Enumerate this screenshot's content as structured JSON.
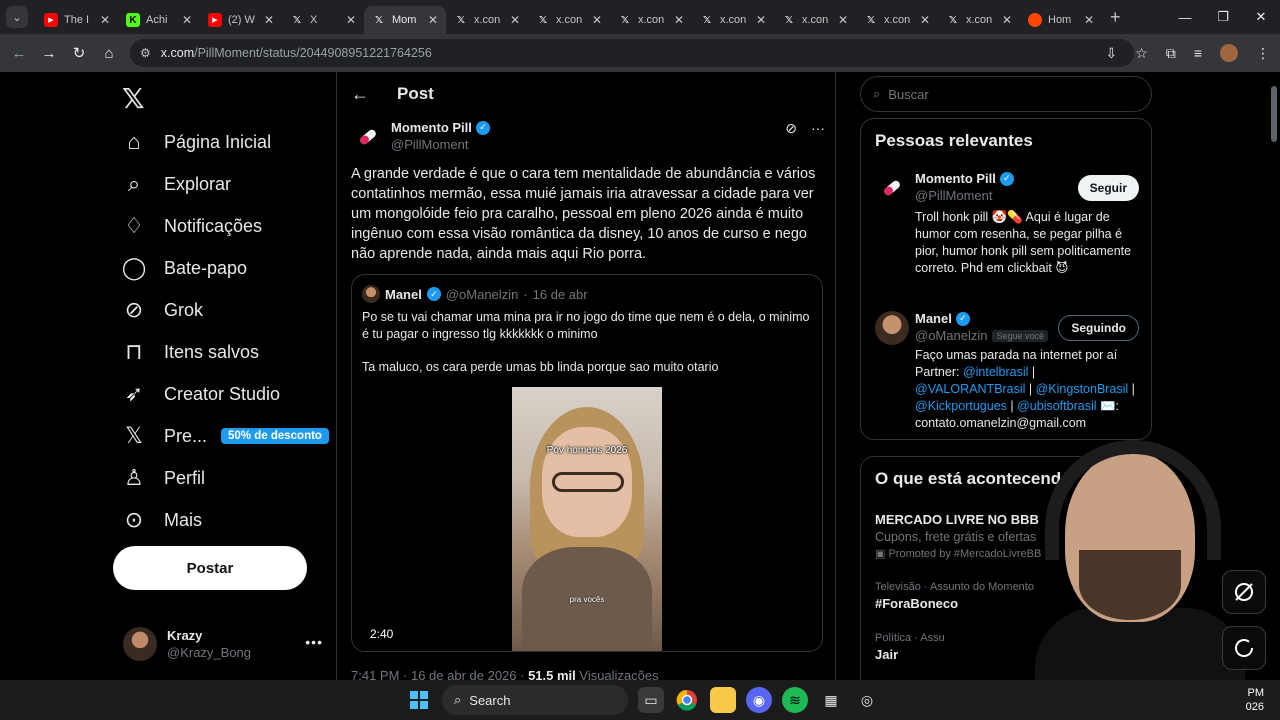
{
  "browser": {
    "tabs": [
      {
        "label": "The I",
        "icon": "youtube-icon",
        "color": "#ff0000",
        "active": false
      },
      {
        "label": "Achi",
        "icon": "kick-icon",
        "color": "#53fc18",
        "active": false
      },
      {
        "label": "(2) W",
        "icon": "youtube-icon",
        "color": "#ff0000",
        "active": false
      },
      {
        "label": "X",
        "icon": "x-icon",
        "color": "#000000",
        "active": false
      },
      {
        "label": "Mom",
        "icon": "x-icon",
        "color": "#000000",
        "active": true
      },
      {
        "label": "x.con",
        "icon": "x-icon",
        "color": "#000000",
        "active": false
      },
      {
        "label": "x.con",
        "icon": "x-icon",
        "color": "#000000",
        "active": false
      },
      {
        "label": "x.con",
        "icon": "x-icon",
        "color": "#000000",
        "active": false
      },
      {
        "label": "x.con",
        "icon": "x-icon",
        "color": "#000000",
        "active": false
      },
      {
        "label": "x.con",
        "icon": "x-icon",
        "color": "#000000",
        "active": false
      },
      {
        "label": "x.con",
        "icon": "x-icon",
        "color": "#000000",
        "active": false
      },
      {
        "label": "x.con",
        "icon": "x-icon",
        "color": "#000000",
        "active": false
      },
      {
        "label": "Hom",
        "icon": "reddit-icon",
        "color": "#ff4500",
        "active": false
      }
    ],
    "url_host": "x.com",
    "url_path": "/PillMoment/status/2044908951221764256"
  },
  "nav": {
    "items": [
      {
        "label": "Página Inicial",
        "icon": "home-icon"
      },
      {
        "label": "Explorar",
        "icon": "search-icon"
      },
      {
        "label": "Notificações",
        "icon": "bell-icon"
      },
      {
        "label": "Bate-papo",
        "icon": "chat-icon"
      },
      {
        "label": "Grok",
        "icon": "grok-icon"
      },
      {
        "label": "Itens salvos",
        "icon": "bookmark-icon"
      },
      {
        "label": "Creator Studio",
        "icon": "rocket-icon"
      },
      {
        "label": "Pre...",
        "icon": "x-premium-icon"
      },
      {
        "label": "Perfil",
        "icon": "person-icon"
      },
      {
        "label": "Mais",
        "icon": "more-circle-icon"
      }
    ],
    "premium_badge": "50% de desconto",
    "post_button": "Postar",
    "account": {
      "name": "Krazy",
      "handle": "@Krazy_Bong"
    }
  },
  "post": {
    "header_title": "Post",
    "author_name": "Momento Pill",
    "author_handle": "@PillMoment",
    "text": "A grande verdade é que o cara tem mentalidade de abundância e vários contatinhos mermão, essa muié jamais iria atravessar a cidade para ver um mongolóide feio pra caralho, pessoal em pleno 2026 ainda é muito ingênuo com essa visão romântica da disney, 10 anos de curso e nego não aprende nada, ainda mais aqui Rio porra.",
    "quote": {
      "name": "Manel",
      "handle": "@oManelzin",
      "date": "16 de abr",
      "text1": "Po se tu vai chamar uma mina pra ir no jogo do time que nem é o dela, o minimo é tu pagar o ingresso tlg kkkkkkk o minimo",
      "text2": "Ta maluco, os cara perde umas bb linda porque sao muito otario",
      "video_caption": "Pov homens 2026",
      "video_subtitle": "pra vocês",
      "video_duration": "2:40"
    },
    "meta_time": "7:41 PM · 16 de abr de 2026 · ",
    "meta_views": "51.5 mil",
    "meta_views_label": " Visualizações"
  },
  "right": {
    "search_placeholder": "Buscar",
    "relevant_title": "Pessoas relevantes",
    "people": [
      {
        "name": "Momento Pill",
        "handle": "@PillMoment",
        "button": "Seguir",
        "bio": "Troll honk pill 🤡💊 Aqui é lugar de humor com resenha, se pegar pilha é pior, humor honk pill sem politicamente correto. Phd em clickbait 😈"
      },
      {
        "name": "Manel",
        "handle": "@oManelzin",
        "follows_you": "Segue você",
        "button": "Seguindo",
        "bio_line1": "Faço umas parada na internet por aí",
        "bio_line2": "Partner: ",
        "links": [
          "@intelbrasil",
          "@VALORANTBrasil",
          "@KingstonBrasil",
          "@Kickportugues",
          "@ubisoftbrasil"
        ],
        "bio_email": "contato.omanelzin@gmail.com"
      }
    ],
    "trends_title": "O que está acontecend",
    "trends": [
      {
        "category": "",
        "title": "MERCADO LIVRE NO BBB",
        "sub": "Cupons, frete grátis e ofertas",
        "promo": "Promoted by #MercadoLivreBB"
      },
      {
        "category": "Televisão · Assunto do Momento",
        "title": "#ForaBoneco"
      },
      {
        "category": "Política · Assu",
        "title": "Jair"
      }
    ]
  },
  "taskbar": {
    "search_label": "Search",
    "clock_line1": "PM",
    "clock_line2": "026"
  }
}
